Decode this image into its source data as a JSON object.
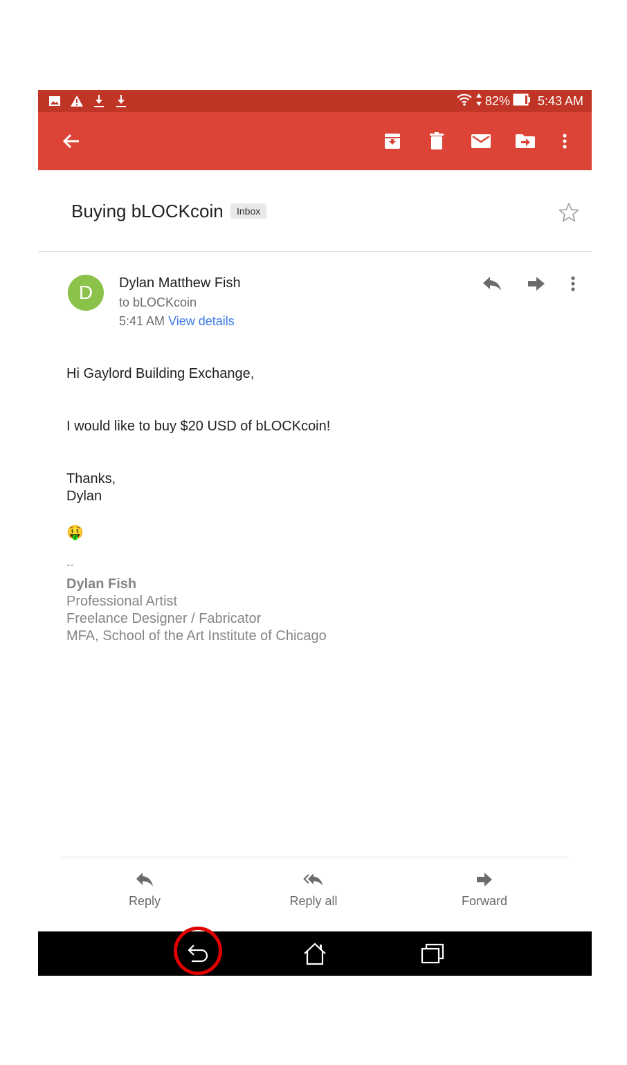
{
  "status_bar": {
    "battery": "82%",
    "time": "5:43 AM",
    "icons": [
      "image-icon",
      "warning-icon",
      "download-icon",
      "download-icon",
      "wifi-icon",
      "data-arrows-icon",
      "battery-icon"
    ]
  },
  "app_bar": {
    "icons": [
      "back-arrow-icon",
      "archive-icon",
      "delete-icon",
      "mark-unread-icon",
      "move-to-icon",
      "more-options-icon"
    ]
  },
  "thread": {
    "subject": "Buying bLOCKcoin",
    "label": "Inbox"
  },
  "message": {
    "avatar_letter": "D",
    "avatar_color": "#8bc34a",
    "sender": "Dylan Matthew Fish",
    "to": "to bLOCKcoin",
    "time": "5:41 AM",
    "view_details": "View details",
    "body": {
      "greeting": "Hi Gaylord Building Exchange,",
      "line1": "I would like to buy $20 USD of bLOCKcoin!",
      "closing1": "Thanks,",
      "closing2": "Dylan",
      "emoji": "🤑"
    },
    "signature": {
      "separator": "--",
      "name": "Dylan Fish",
      "line1": "Professional Artist",
      "line2": "Freelance Designer / Fabricator",
      "line3": "MFA, School of the Art Institute of Chicago"
    }
  },
  "actions": {
    "reply": "Reply",
    "reply_all": "Reply all",
    "forward": "Forward"
  },
  "colors": {
    "status_bar": "#c03525",
    "app_bar": "#db4437",
    "link": "#3b78e7",
    "highlight": "#e00000"
  }
}
